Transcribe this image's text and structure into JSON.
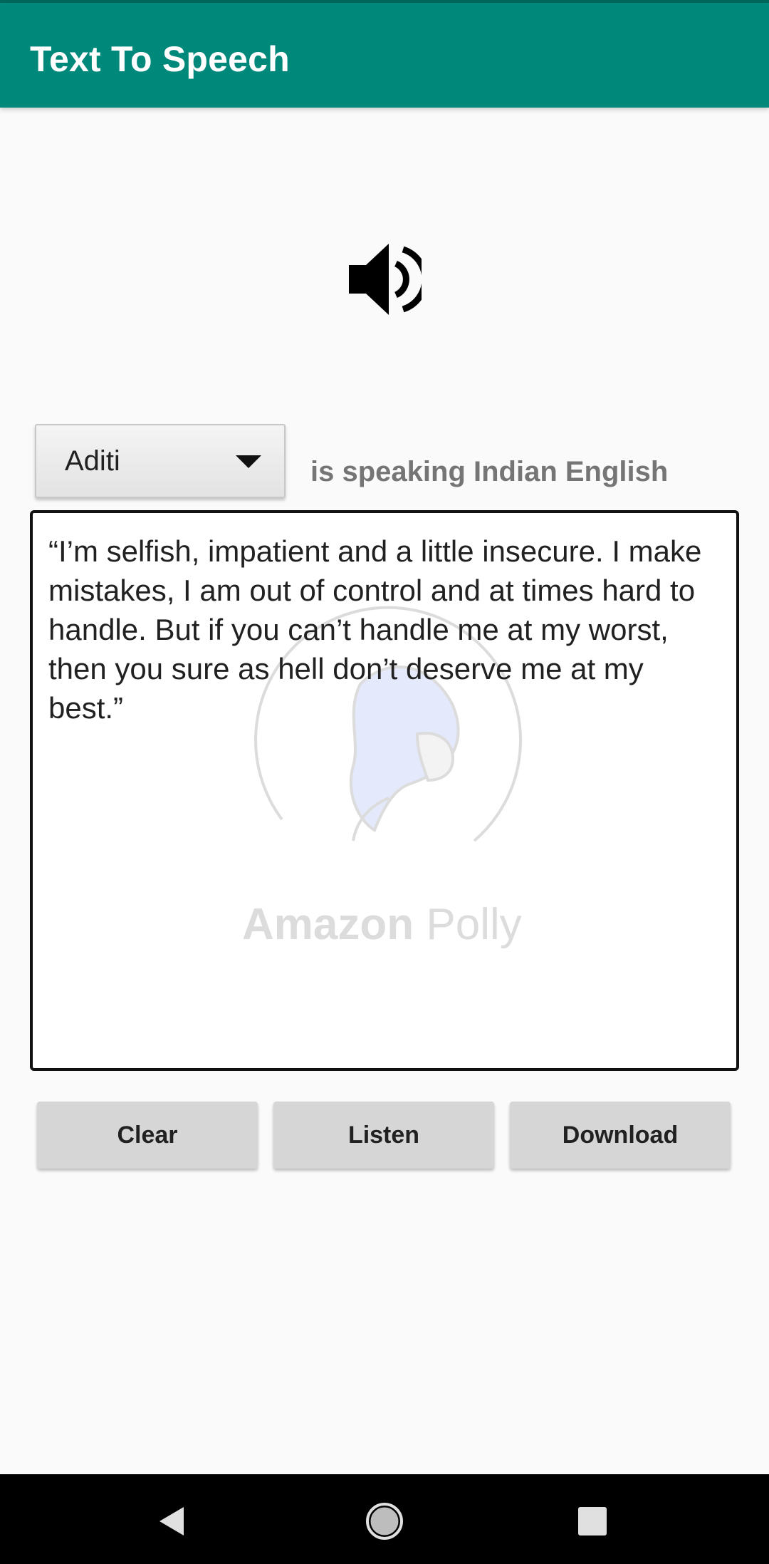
{
  "app_bar": {
    "title": "Text To Speech"
  },
  "speaker_icon": "speaker-volume-icon",
  "voice": {
    "selected": "Aditi",
    "description": "is speaking Indian English"
  },
  "editor": {
    "text": "“I’m selfish, impatient and a little insecure. I make mistakes, I am out of control and at times hard to handle. But if you can’t handle me at my worst, then you sure as hell don’t deserve me at my best.”",
    "watermark_bold": "Amazon",
    "watermark_light": "Polly"
  },
  "buttons": {
    "clear": "Clear",
    "listen": "Listen",
    "download": "Download"
  },
  "colors": {
    "primary": "#00897b",
    "primary_dark": "#00695c"
  },
  "nav_icons": [
    "back-icon",
    "home-icon",
    "recents-icon"
  ]
}
